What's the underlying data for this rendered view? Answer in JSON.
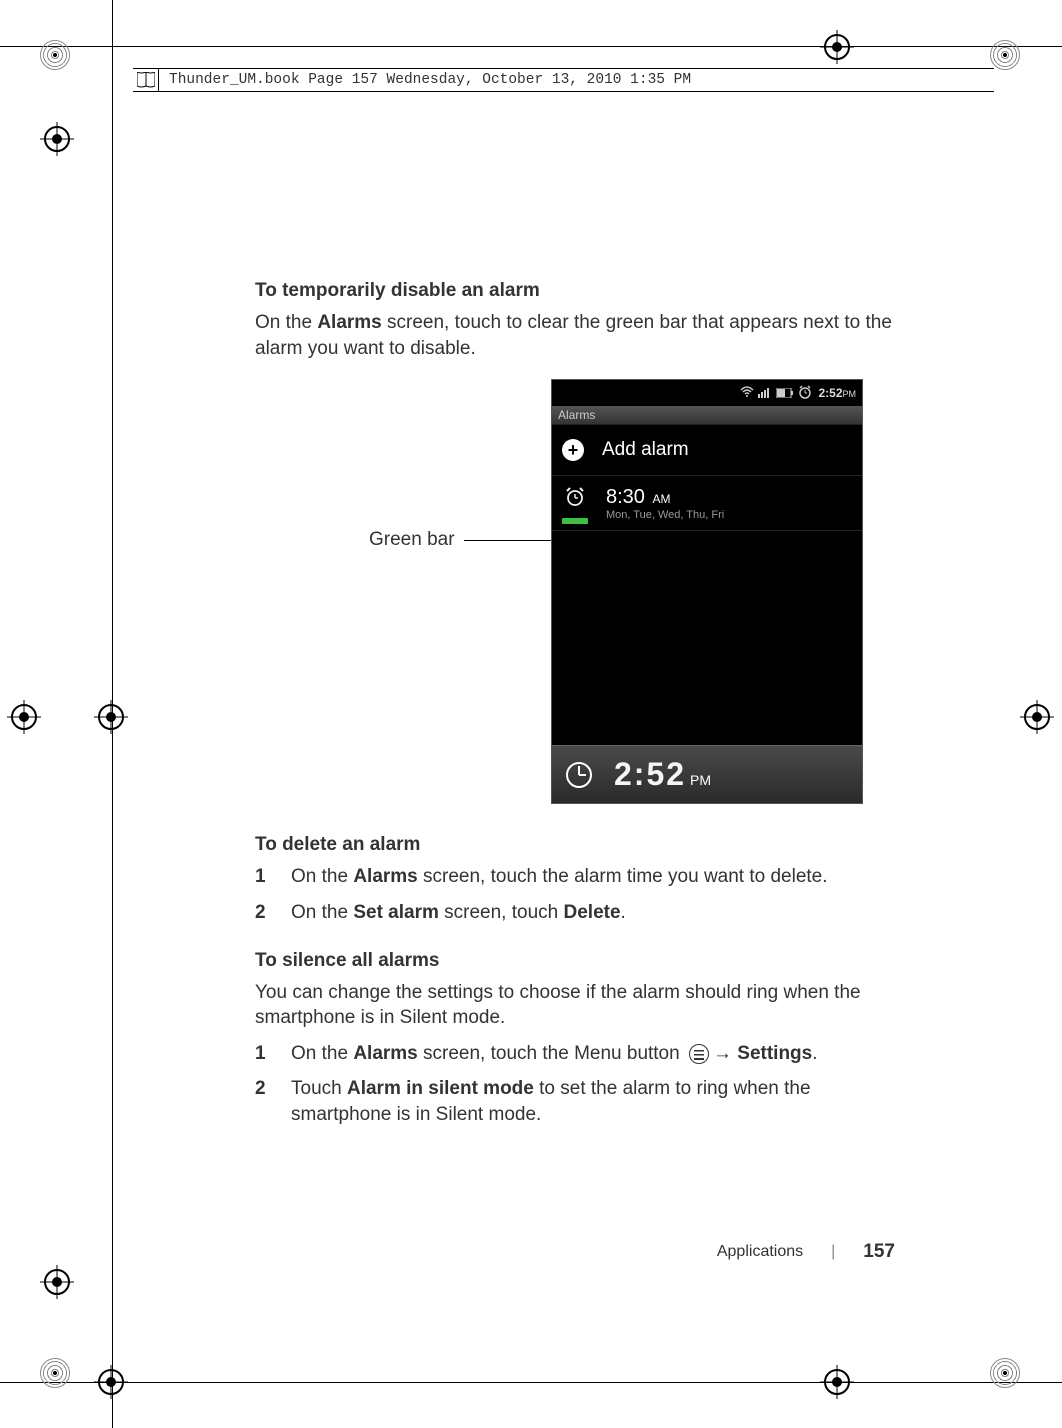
{
  "header_text": "Thunder_UM.book  Page 157  Wednesday, October 13, 2010  1:35 PM",
  "section1": {
    "heading": "To temporarily disable an alarm",
    "body_pre": "On the ",
    "body_b1": "Alarms",
    "body_post": " screen, touch to clear the green bar that appears next to the alarm you want to disable."
  },
  "callout": "Green bar",
  "phone": {
    "status_time": "2:52",
    "status_ampm": "PM",
    "label": "Alarms",
    "add": "Add alarm",
    "alarm_time": "8:30",
    "alarm_ampm": "AM",
    "alarm_days": "Mon, Tue, Wed, Thu, Fri",
    "footer_time": "2:52",
    "footer_ampm": "PM"
  },
  "section2": {
    "heading": "To delete an alarm",
    "step1_pre": "On the ",
    "step1_b": "Alarms",
    "step1_post": " screen, touch the alarm time you want to delete.",
    "step2_pre": "On the ",
    "step2_b1": "Set alarm",
    "step2_mid": " screen, touch ",
    "step2_b2": "Delete",
    "step2_post": "."
  },
  "section3": {
    "heading": "To silence all alarms",
    "body": "You can change the settings to choose if the alarm should ring when the smartphone is in Silent mode.",
    "step1_pre": "On the ",
    "step1_b1": "Alarms",
    "step1_mid": " screen, touch the Menu button ",
    "step1_arrow": "→ ",
    "step1_b2": "Settings",
    "step1_post": ".",
    "step2_pre": "Touch ",
    "step2_b": "Alarm in silent mode",
    "step2_post": " to set the alarm to ring when the smartphone is in Silent mode."
  },
  "footer": {
    "section": "Applications",
    "page": "157"
  }
}
